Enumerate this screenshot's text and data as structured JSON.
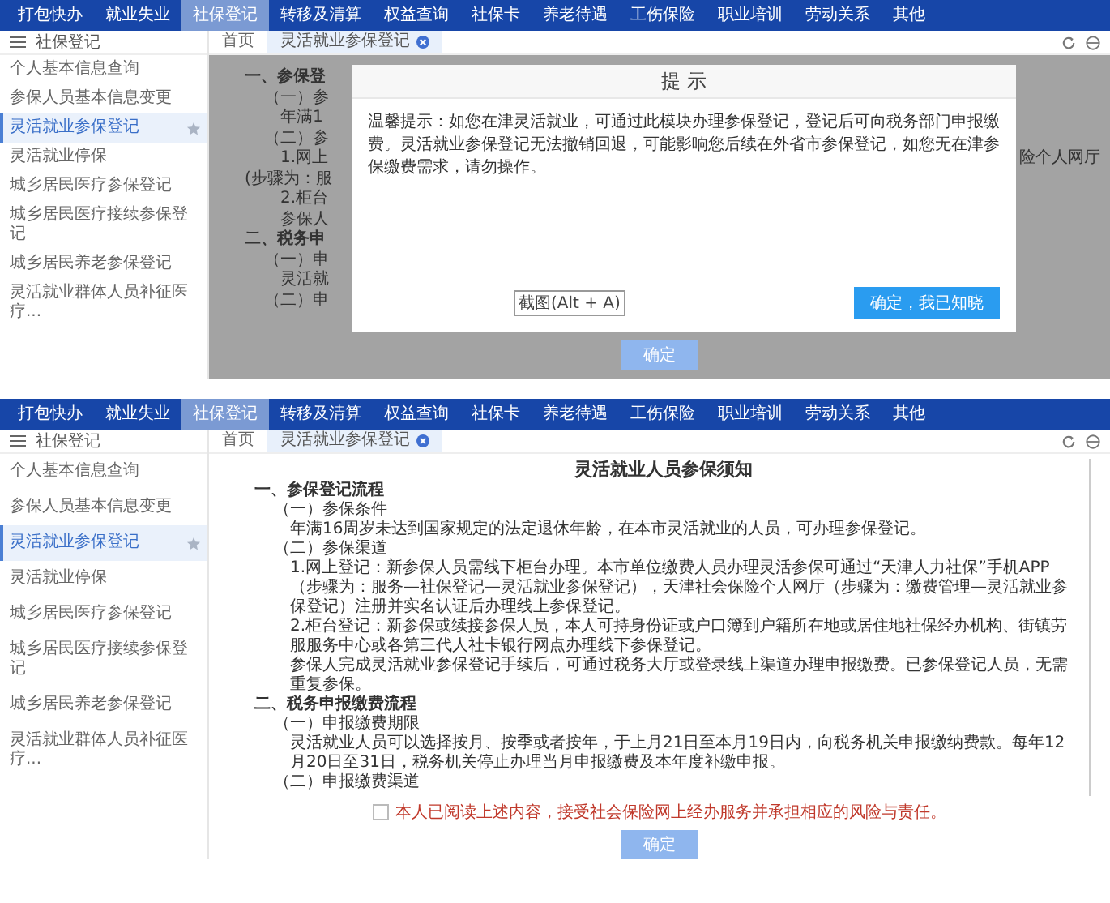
{
  "screens": [
    {
      "nav": [
        {
          "label": "打包快办",
          "selected": false
        },
        {
          "label": "就业失业",
          "selected": false
        },
        {
          "label": "社保登记",
          "selected": true
        },
        {
          "label": "转移及清算",
          "selected": false
        },
        {
          "label": "权益查询",
          "selected": false
        },
        {
          "label": "社保卡",
          "selected": false
        },
        {
          "label": "养老待遇",
          "selected": false
        },
        {
          "label": "工伤保险",
          "selected": false
        },
        {
          "label": "职业培训",
          "selected": false
        },
        {
          "label": "劳动关系",
          "selected": false
        },
        {
          "label": "其他",
          "selected": false
        }
      ],
      "sidebar": {
        "title": "社保登记",
        "items": [
          {
            "label": "个人基本信息查询",
            "selected": false
          },
          {
            "label": "参保人员基本信息变更",
            "selected": false
          },
          {
            "label": "灵活就业参保登记",
            "selected": true
          },
          {
            "label": "灵活就业停保",
            "selected": false
          },
          {
            "label": "城乡居民医疗参保登记",
            "selected": false
          },
          {
            "label": "城乡居民医疗接续参保登记",
            "selected": false
          },
          {
            "label": "城乡居民养老参保登记",
            "selected": false
          },
          {
            "label": "灵活就业群体人员补征医疗...",
            "selected": false
          }
        ]
      },
      "tabs": [
        {
          "label": "首页",
          "selected": false,
          "closable": false
        },
        {
          "label": "灵活就业参保登记",
          "selected": true,
          "closable": true
        }
      ],
      "fragments": [
        {
          "kind": "heading",
          "text": "一、参保登"
        },
        {
          "kind": "sub",
          "text": "（一）参"
        },
        {
          "kind": "para",
          "text": "年满1"
        },
        {
          "kind": "sub",
          "text": "（二）参"
        },
        {
          "kind": "para",
          "text": "1.网上",
          "tail": "险个人网厅"
        },
        {
          "kind": "plain",
          "text": "(步骤为：服"
        },
        {
          "kind": "para",
          "text": "2.柜台"
        },
        {
          "kind": "para",
          "text": "参保人"
        },
        {
          "kind": "heading",
          "text": "二、税务申"
        },
        {
          "kind": "sub",
          "text": "（一）申"
        },
        {
          "kind": "para",
          "text": "灵活就"
        },
        {
          "kind": "sub",
          "text": "（二）申"
        }
      ],
      "dialog": {
        "title": "提 示",
        "message": "温馨提示：如您在津灵活就业，可通过此模块办理参保登记，登记后可向税务部门申报缴费。灵活就业参保登记无法撤销回退，可能影响您后续在外省市参保登记，如您无在津参保缴费需求，请勿操作。",
        "hint": "截图(Alt + A)",
        "confirm": "确定，我已知晓"
      },
      "submit": {
        "label": "确定",
        "disabled": true
      }
    },
    {
      "nav": [
        {
          "label": "打包快办",
          "selected": false
        },
        {
          "label": "就业失业",
          "selected": false
        },
        {
          "label": "社保登记",
          "selected": true
        },
        {
          "label": "转移及清算",
          "selected": false
        },
        {
          "label": "权益查询",
          "selected": false
        },
        {
          "label": "社保卡",
          "selected": false
        },
        {
          "label": "养老待遇",
          "selected": false
        },
        {
          "label": "工伤保险",
          "selected": false
        },
        {
          "label": "职业培训",
          "selected": false
        },
        {
          "label": "劳动关系",
          "selected": false
        },
        {
          "label": "其他",
          "selected": false
        }
      ],
      "sidebar": {
        "title": "社保登记",
        "items": [
          {
            "label": "个人基本信息查询",
            "selected": false
          },
          {
            "label": "参保人员基本信息变更",
            "selected": false
          },
          {
            "label": "灵活就业参保登记",
            "selected": true
          },
          {
            "label": "灵活就业停保",
            "selected": false
          },
          {
            "label": "城乡居民医疗参保登记",
            "selected": false
          },
          {
            "label": "城乡居民医疗接续参保登记",
            "selected": false
          },
          {
            "label": "城乡居民养老参保登记",
            "selected": false
          },
          {
            "label": "灵活就业群体人员补征医疗...",
            "selected": false
          }
        ]
      },
      "tabs": [
        {
          "label": "首页",
          "selected": false,
          "closable": false
        },
        {
          "label": "灵活就业参保登记",
          "selected": true,
          "closable": true
        }
      ],
      "notice": {
        "title": "灵活就业人员参保须知",
        "items": [
          {
            "kind": "heading",
            "text": "一、参保登记流程"
          },
          {
            "kind": "sub",
            "text": "（一）参保条件"
          },
          {
            "kind": "para",
            "text": "年满16周岁未达到国家规定的法定退休年龄，在本市灵活就业的人员，可办理参保登记。"
          },
          {
            "kind": "sub",
            "text": "（二）参保渠道"
          },
          {
            "kind": "para",
            "text": "1.网上登记：新参保人员需线下柜台办理。本市单位缴费人员办理灵活参保可通过“天津人力社保”手机APP（步骤为：服务—社保登记—灵活就业参保登记），天津社会保险个人网厅（步骤为：缴费管理—灵活就业参保登记）注册并实名认证后办理线上参保登记。"
          },
          {
            "kind": "para",
            "text": "2.柜台登记：新参保或续接参保人员，本人可持身份证或户口簿到户籍所在地或居住地社保经办机构、街镇劳服服务中心或各第三代人社卡银行网点办理线下参保登记。"
          },
          {
            "kind": "para",
            "text": "参保人完成灵活就业参保登记手续后，可通过税务大厅或登录线上渠道办理申报缴费。已参保登记人员，无需重复参保。"
          },
          {
            "kind": "heading",
            "text": "二、税务申报缴费流程"
          },
          {
            "kind": "sub",
            "text": "（一）申报缴费期限"
          },
          {
            "kind": "para",
            "text": "灵活就业人员可以选择按月、按季或者按年，于上月21日至本月19日内，向税务机关申报缴纳费款。每年12月20日至31日，税务机关停止办理当月申报缴费及本年度补缴申报。"
          },
          {
            "kind": "sub",
            "text": "（二）申报缴费渠道"
          }
        ]
      },
      "agreement": {
        "label": "本人已阅读上述内容，接受社会保险网上经办服务并承担相应的风险与责任。",
        "checked": false
      },
      "submit": {
        "label": "确定",
        "disabled": true
      }
    }
  ]
}
